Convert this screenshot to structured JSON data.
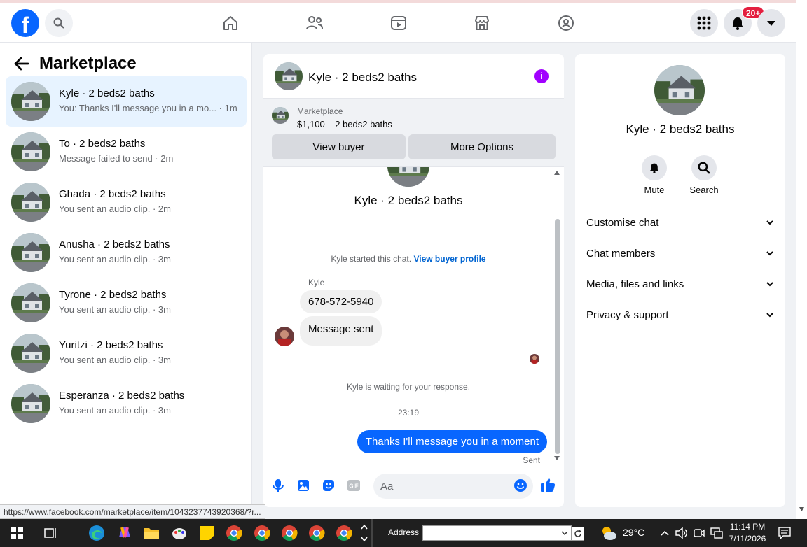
{
  "nav": {
    "logo": "f",
    "notif_badge": "20+"
  },
  "left": {
    "title": "Marketplace",
    "conversations": [
      {
        "name": "Kyle · 2 beds2 baths",
        "sub": "You: Thanks I'll message you in a mo... · 1m"
      },
      {
        "name": "To · 2 beds2 baths",
        "sub": "Message failed to send · 2m"
      },
      {
        "name": "Ghada · 2 beds2 baths",
        "sub": "You sent an audio clip. · 2m"
      },
      {
        "name": "Anusha · 2 beds2 baths",
        "sub": "You sent an audio clip. · 3m"
      },
      {
        "name": "Tyrone · 2 beds2 baths",
        "sub": "You sent an audio clip. · 3m"
      },
      {
        "name": "Yuritzi · 2 beds2 baths",
        "sub": "You sent an audio clip. · 3m"
      },
      {
        "name": "Esperanza · 2 beds2 baths",
        "sub": "You sent an audio clip. · 3m"
      }
    ]
  },
  "chat": {
    "title": "Kyle · 2 beds2 baths",
    "info_glyph": "i",
    "marketplace_label": "Marketplace",
    "listing": "$1,100 – 2 beds2 baths",
    "view_buyer": "View buyer",
    "more_options": "More Options",
    "body_name": "Kyle · 2 beds2 baths",
    "started_text": "Kyle started this chat.",
    "view_profile": "View buyer profile",
    "sender": "Kyle",
    "msg1": "678-572-5940",
    "msg2": "Message sent",
    "waiting": "Kyle is waiting for your response.",
    "time": "23:19",
    "out_msg": "Thanks I'll message you in a moment",
    "sent": "Sent",
    "input_placeholder": "Aa"
  },
  "right": {
    "name": "Kyle · 2 beds2 baths",
    "mute": "Mute",
    "search": "Search",
    "sections": [
      "Customise chat",
      "Chat members",
      "Media, files and links",
      "Privacy & support"
    ]
  },
  "status_url": "https://www.facebook.com/marketplace/item/1043237743920368/?r...",
  "taskbar": {
    "address_label": "Address",
    "weather": "29°C",
    "time": "11:14 PM",
    "date": "7/11/2026"
  },
  "colors": {
    "accent": "#0866ff",
    "badge": "#e41e3f",
    "info": "#a100ff"
  }
}
